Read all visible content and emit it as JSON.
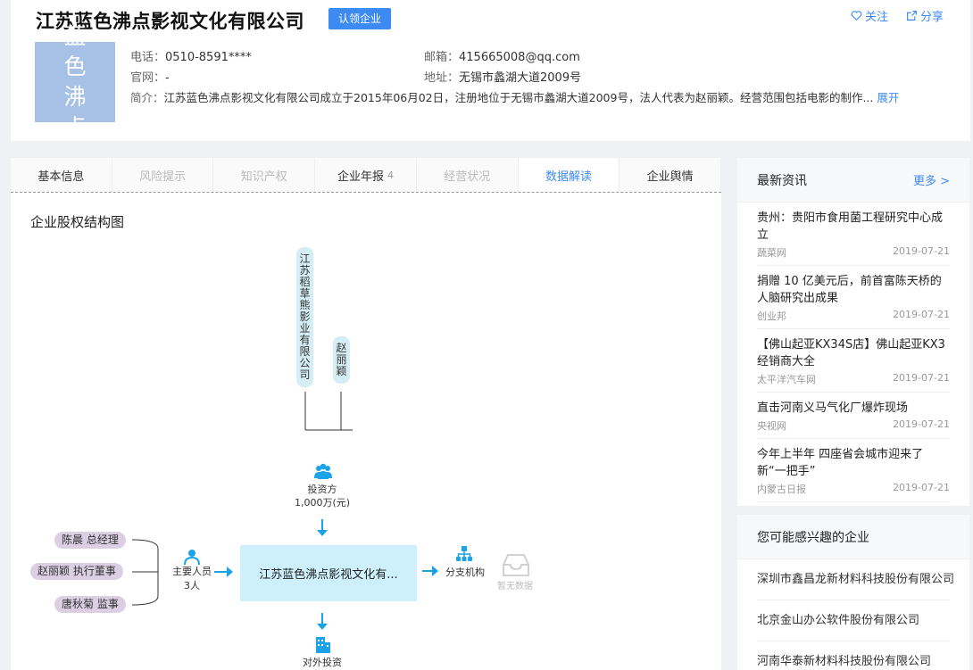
{
  "company": {
    "name": "江苏蓝色沸点影视文化有限公司",
    "badge": "认领企业",
    "logo_text": [
      "蓝 色",
      "沸 点"
    ],
    "follow": "关注",
    "share": "分享",
    "phone_label": "电话：",
    "phone": "0510-8591****",
    "email_label": "邮箱：",
    "email": "415665008@qq.com",
    "site_label": "官网：",
    "site": "-",
    "address_label": "地址：",
    "address": "无锡市蠡湖大道2009号",
    "intro_label": "简介：",
    "intro": "江苏蓝色沸点影视文化有限公司成立于2015年06月02日，注册地位于无锡市蠡湖大道2009号，法人代表为赵丽颖。经营范围包括电影的制作...",
    "expand": "展开"
  },
  "tabs": [
    {
      "label": "基本信息",
      "state": "black"
    },
    {
      "label": "风险提示",
      "state": "gray"
    },
    {
      "label": "知识产权",
      "state": "gray"
    },
    {
      "label": "企业年报",
      "count": "4",
      "state": "black"
    },
    {
      "label": "经营状况",
      "state": "gray"
    },
    {
      "label": "数据解读",
      "state": "active"
    },
    {
      "label": "企业舆情",
      "state": "black"
    }
  ],
  "graph": {
    "title": "企业股权结构图",
    "shareholder1": "江苏稻草熊影业有限公司",
    "shareholder2": "赵丽颖",
    "investor_label": "投资方",
    "investor_amount": "1,000万(元)",
    "center": "江苏蓝色沸点影视文化有...",
    "staff_label": "主要人员",
    "staff_count": "3人",
    "people": [
      "陈晨 总经理",
      "赵丽颖 执行董事",
      "唐秋菊 监事"
    ],
    "branch_label": "分支机构",
    "no_data": "暂无数据",
    "outward_label": "对外投资"
  },
  "news": {
    "title": "最新资讯",
    "more": "更多 >",
    "items": [
      {
        "title": "贵州：贵阳市食用菌工程研究中心成立",
        "source": "蔬菜网",
        "date": "2019-07-21"
      },
      {
        "title": "捐赠 10 亿美元后，前首富陈天桥的人脑研究出成果",
        "source": "创业邦",
        "date": "2019-07-21"
      },
      {
        "title": "【佛山起亚KX34S店】佛山起亚KX3经销商大全",
        "source": "太平洋汽车网",
        "date": "2019-07-21"
      },
      {
        "title": "直击河南义马气化厂爆炸现场",
        "source": "央视网",
        "date": "2019-07-21"
      },
      {
        "title": "今年上半年 四座省会城市迎来了新“一把手”",
        "source": "内蒙古日报",
        "date": "2019-07-21"
      }
    ]
  },
  "interest": {
    "title": "您可能感兴趣的企业",
    "items": [
      "深圳市鑫昌龙新材料科技股份有限公司",
      "北京金山办公软件股份有限公司",
      "河南华泰新材料科技股份有限公司"
    ]
  },
  "colors": {
    "accent": "#3d8bf2",
    "graph_arrow": "#1aa3e8",
    "center_box": "#cdf0fc"
  }
}
